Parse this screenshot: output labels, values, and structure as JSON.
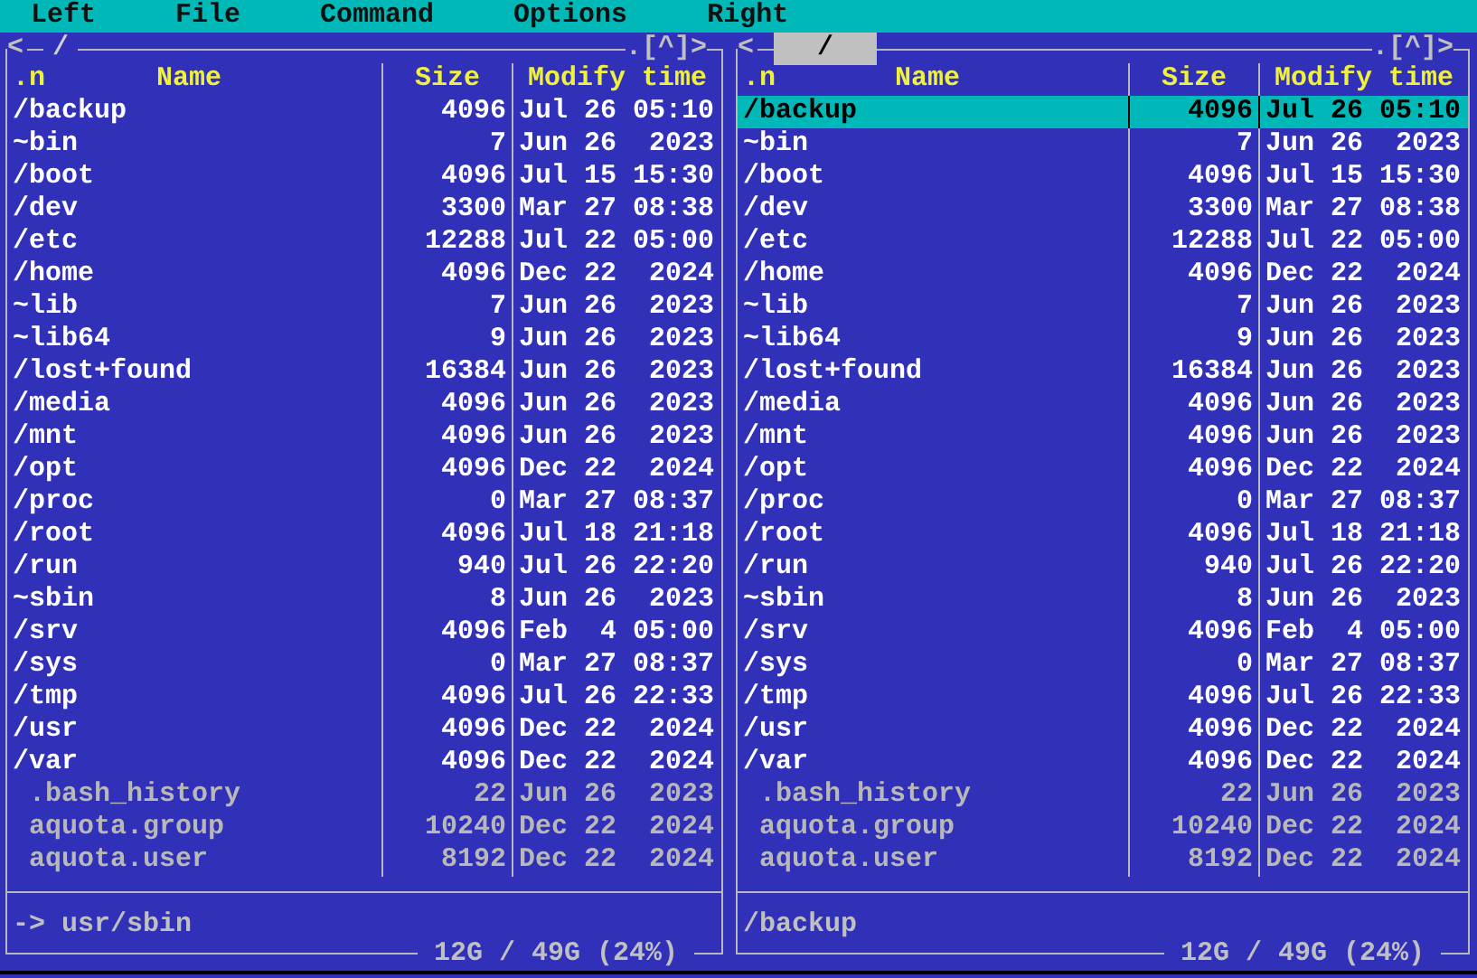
{
  "menu": [
    "Left",
    "File",
    "Command",
    "Options",
    "Right"
  ],
  "panels": [
    {
      "active": false,
      "history": "<",
      "path": "/",
      "controls": ".[^]>",
      "columns": {
        "sort": ".n",
        "name": "Name",
        "size": "Size",
        "time": "Modify time"
      },
      "rows": [
        {
          "kind": "dir",
          "name": "/backup",
          "size": "4096",
          "time": "Jul 26 05:10",
          "selected": false
        },
        {
          "kind": "link",
          "name": "~bin",
          "size": "7",
          "time": "Jun 26  2023",
          "selected": false
        },
        {
          "kind": "dir",
          "name": "/boot",
          "size": "4096",
          "time": "Jul 15 15:30",
          "selected": false
        },
        {
          "kind": "dir",
          "name": "/dev",
          "size": "3300",
          "time": "Mar 27 08:38",
          "selected": false
        },
        {
          "kind": "dir",
          "name": "/etc",
          "size": "12288",
          "time": "Jul 22 05:00",
          "selected": false
        },
        {
          "kind": "dir",
          "name": "/home",
          "size": "4096",
          "time": "Dec 22  2024",
          "selected": false
        },
        {
          "kind": "link",
          "name": "~lib",
          "size": "7",
          "time": "Jun 26  2023",
          "selected": false
        },
        {
          "kind": "link",
          "name": "~lib64",
          "size": "9",
          "time": "Jun 26  2023",
          "selected": false
        },
        {
          "kind": "dir",
          "name": "/lost+found",
          "size": "16384",
          "time": "Jun 26  2023",
          "selected": false
        },
        {
          "kind": "dir",
          "name": "/media",
          "size": "4096",
          "time": "Jun 26  2023",
          "selected": false
        },
        {
          "kind": "dir",
          "name": "/mnt",
          "size": "4096",
          "time": "Jun 26  2023",
          "selected": false
        },
        {
          "kind": "dir",
          "name": "/opt",
          "size": "4096",
          "time": "Dec 22  2024",
          "selected": false
        },
        {
          "kind": "dir",
          "name": "/proc",
          "size": "0",
          "time": "Mar 27 08:37",
          "selected": false
        },
        {
          "kind": "dir",
          "name": "/root",
          "size": "4096",
          "time": "Jul 18 21:18",
          "selected": false
        },
        {
          "kind": "dir",
          "name": "/run",
          "size": "940",
          "time": "Jul 26 22:20",
          "selected": false
        },
        {
          "kind": "link",
          "name": "~sbin",
          "size": "8",
          "time": "Jun 26  2023",
          "selected": false
        },
        {
          "kind": "dir",
          "name": "/srv",
          "size": "4096",
          "time": "Feb  4 05:00",
          "selected": false
        },
        {
          "kind": "dir",
          "name": "/sys",
          "size": "0",
          "time": "Mar 27 08:37",
          "selected": false
        },
        {
          "kind": "dir",
          "name": "/tmp",
          "size": "4096",
          "time": "Jul 26 22:33",
          "selected": false
        },
        {
          "kind": "dir",
          "name": "/usr",
          "size": "4096",
          "time": "Dec 22  2024",
          "selected": false
        },
        {
          "kind": "dir",
          "name": "/var",
          "size": "4096",
          "time": "Dec 22  2024",
          "selected": false
        },
        {
          "kind": "file",
          "name": ".bash_history",
          "size": "22",
          "time": "Jun 26  2023",
          "selected": false
        },
        {
          "kind": "file",
          "name": "aquota.group",
          "size": "10240",
          "time": "Dec 22  2024",
          "selected": false
        },
        {
          "kind": "file",
          "name": "aquota.user",
          "size": "8192",
          "time": "Dec 22  2024",
          "selected": false
        }
      ],
      "mini_status": "-> usr/sbin",
      "disk": "12G / 49G (24%)"
    },
    {
      "active": true,
      "history": "<",
      "path": "/",
      "controls": ".[^]>",
      "columns": {
        "sort": ".n",
        "name": "Name",
        "size": "Size",
        "time": "Modify time"
      },
      "rows": [
        {
          "kind": "dir",
          "name": "/backup",
          "size": "4096",
          "time": "Jul 26 05:10",
          "selected": true
        },
        {
          "kind": "link",
          "name": "~bin",
          "size": "7",
          "time": "Jun 26  2023",
          "selected": false
        },
        {
          "kind": "dir",
          "name": "/boot",
          "size": "4096",
          "time": "Jul 15 15:30",
          "selected": false
        },
        {
          "kind": "dir",
          "name": "/dev",
          "size": "3300",
          "time": "Mar 27 08:38",
          "selected": false
        },
        {
          "kind": "dir",
          "name": "/etc",
          "size": "12288",
          "time": "Jul 22 05:00",
          "selected": false
        },
        {
          "kind": "dir",
          "name": "/home",
          "size": "4096",
          "time": "Dec 22  2024",
          "selected": false
        },
        {
          "kind": "link",
          "name": "~lib",
          "size": "7",
          "time": "Jun 26  2023",
          "selected": false
        },
        {
          "kind": "link",
          "name": "~lib64",
          "size": "9",
          "time": "Jun 26  2023",
          "selected": false
        },
        {
          "kind": "dir",
          "name": "/lost+found",
          "size": "16384",
          "time": "Jun 26  2023",
          "selected": false
        },
        {
          "kind": "dir",
          "name": "/media",
          "size": "4096",
          "time": "Jun 26  2023",
          "selected": false
        },
        {
          "kind": "dir",
          "name": "/mnt",
          "size": "4096",
          "time": "Jun 26  2023",
          "selected": false
        },
        {
          "kind": "dir",
          "name": "/opt",
          "size": "4096",
          "time": "Dec 22  2024",
          "selected": false
        },
        {
          "kind": "dir",
          "name": "/proc",
          "size": "0",
          "time": "Mar 27 08:37",
          "selected": false
        },
        {
          "kind": "dir",
          "name": "/root",
          "size": "4096",
          "time": "Jul 18 21:18",
          "selected": false
        },
        {
          "kind": "dir",
          "name": "/run",
          "size": "940",
          "time": "Jul 26 22:20",
          "selected": false
        },
        {
          "kind": "link",
          "name": "~sbin",
          "size": "8",
          "time": "Jun 26  2023",
          "selected": false
        },
        {
          "kind": "dir",
          "name": "/srv",
          "size": "4096",
          "time": "Feb  4 05:00",
          "selected": false
        },
        {
          "kind": "dir",
          "name": "/sys",
          "size": "0",
          "time": "Mar 27 08:37",
          "selected": false
        },
        {
          "kind": "dir",
          "name": "/tmp",
          "size": "4096",
          "time": "Jul 26 22:33",
          "selected": false
        },
        {
          "kind": "dir",
          "name": "/usr",
          "size": "4096",
          "time": "Dec 22  2024",
          "selected": false
        },
        {
          "kind": "dir",
          "name": "/var",
          "size": "4096",
          "time": "Dec 22  2024",
          "selected": false
        },
        {
          "kind": "file",
          "name": ".bash_history",
          "size": "22",
          "time": "Jun 26  2023",
          "selected": false
        },
        {
          "kind": "file",
          "name": "aquota.group",
          "size": "10240",
          "time": "Dec 22  2024",
          "selected": false
        },
        {
          "kind": "file",
          "name": "aquota.user",
          "size": "8192",
          "time": "Dec 22  2024",
          "selected": false
        }
      ],
      "mini_status": "/backup",
      "disk": "12G / 49G (24%)"
    }
  ]
}
